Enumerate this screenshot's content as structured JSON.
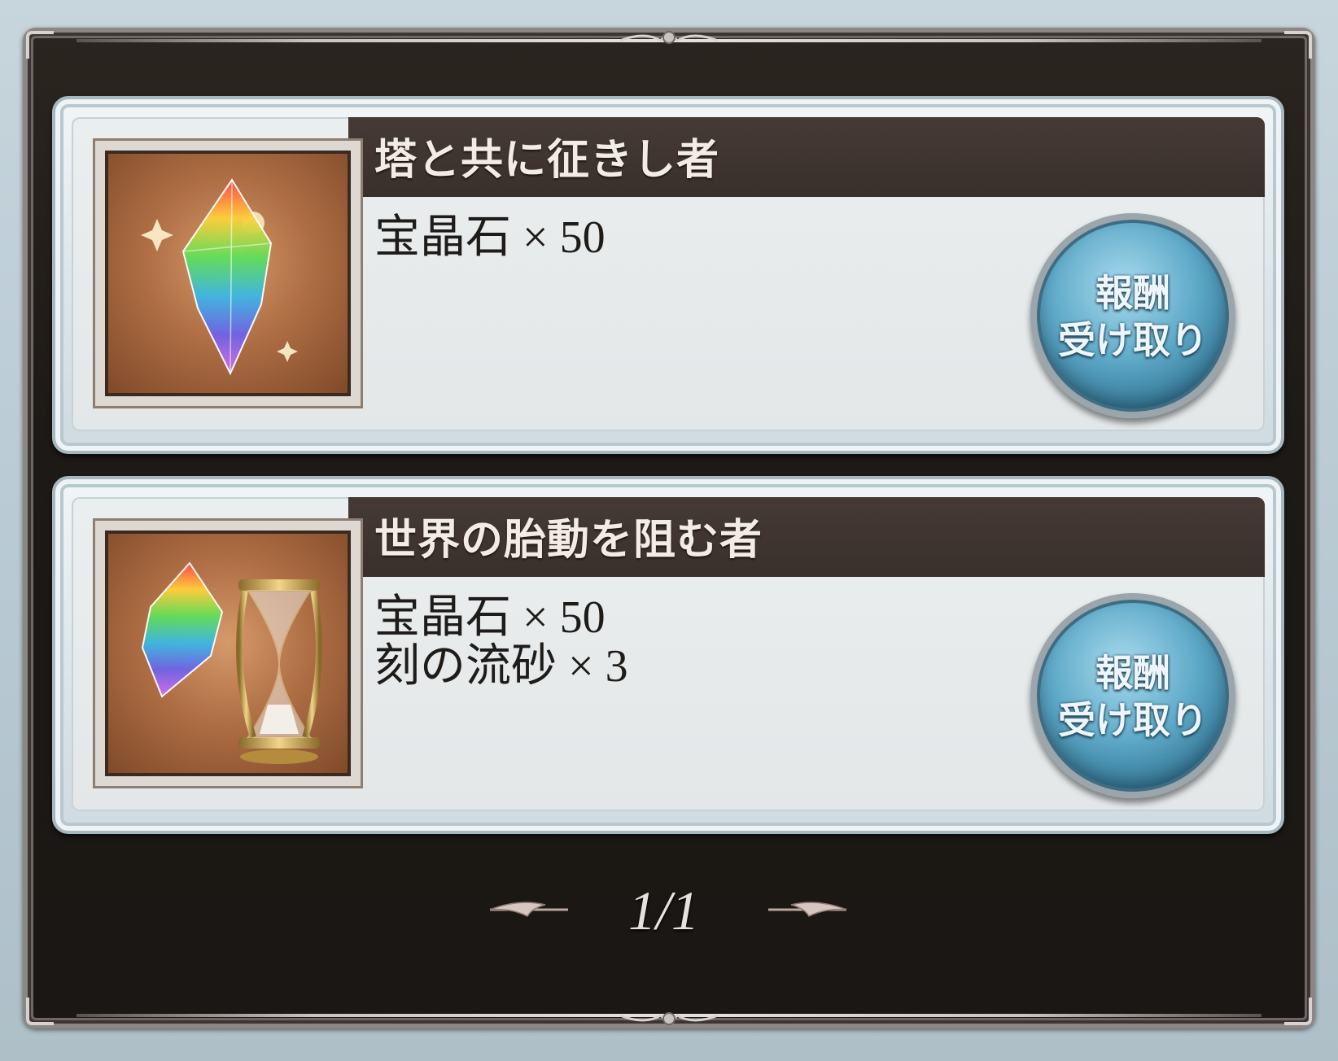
{
  "rewards": [
    {
      "title": "塔と共に征きし者",
      "items": [
        "宝晶石 × 50"
      ],
      "icon": "rainbow-crystal-icon",
      "button": {
        "line1": "報酬",
        "line2": "受け取り"
      }
    },
    {
      "title": "世界の胎動を阻む者",
      "items": [
        "宝晶石 × 50",
        "刻の流砂 × 3"
      ],
      "icon": "crystal-and-hourglass-icon",
      "button": {
        "line1": "報酬",
        "line2": "受け取り"
      }
    }
  ],
  "pagination": {
    "text": "1/1"
  },
  "colors": {
    "title_bar": "#3d322d",
    "card_bg": "#e3e7e8",
    "button_blue": "#5ea9c8",
    "frame_dark": "#1d1916"
  }
}
